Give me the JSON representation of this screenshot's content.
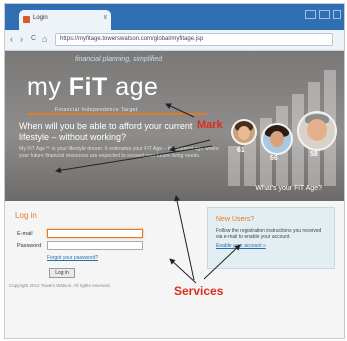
{
  "browser": {
    "tab_title": "Login",
    "close_glyph": "x",
    "back_glyph": "‹",
    "forward_glyph": "›",
    "refresh_glyph": "C",
    "home_glyph": "⌂",
    "url": "https://myfitage.towerswatson.com/global/myfitage.jsp"
  },
  "hero": {
    "tagline": "financial planning, simplified",
    "logo_my": "my ",
    "logo_fit": "FiT",
    "logo_age": " age",
    "logo_sub": "Financial Independence Target",
    "question": "When will you be able to afford your current lifestyle – without working?",
    "description": "My FiT Age™ is your lifestyle dream. It estimates your FiT Age – the earliest age where your future financial resources are expected to exceed your future living needs.",
    "whats": "What's your FiT Age?",
    "ages": [
      "61",
      "56",
      "58"
    ]
  },
  "login": {
    "title": "Log in",
    "email_label": "E-mail",
    "password_label": "Password",
    "email_value": "",
    "password_value": "",
    "forgot_link": "Forgot your password?",
    "button": "Log in",
    "copyright": "Copyright 2012 Towers Watson. All rights reserved."
  },
  "new_users": {
    "title": "New Users?",
    "description": "Follow the registration instructions you received via e-mail to enable your account.",
    "link": "Enable your account »"
  },
  "annotations": {
    "mark": "Mark",
    "services": "Services",
    "color": "#e12b1f"
  }
}
